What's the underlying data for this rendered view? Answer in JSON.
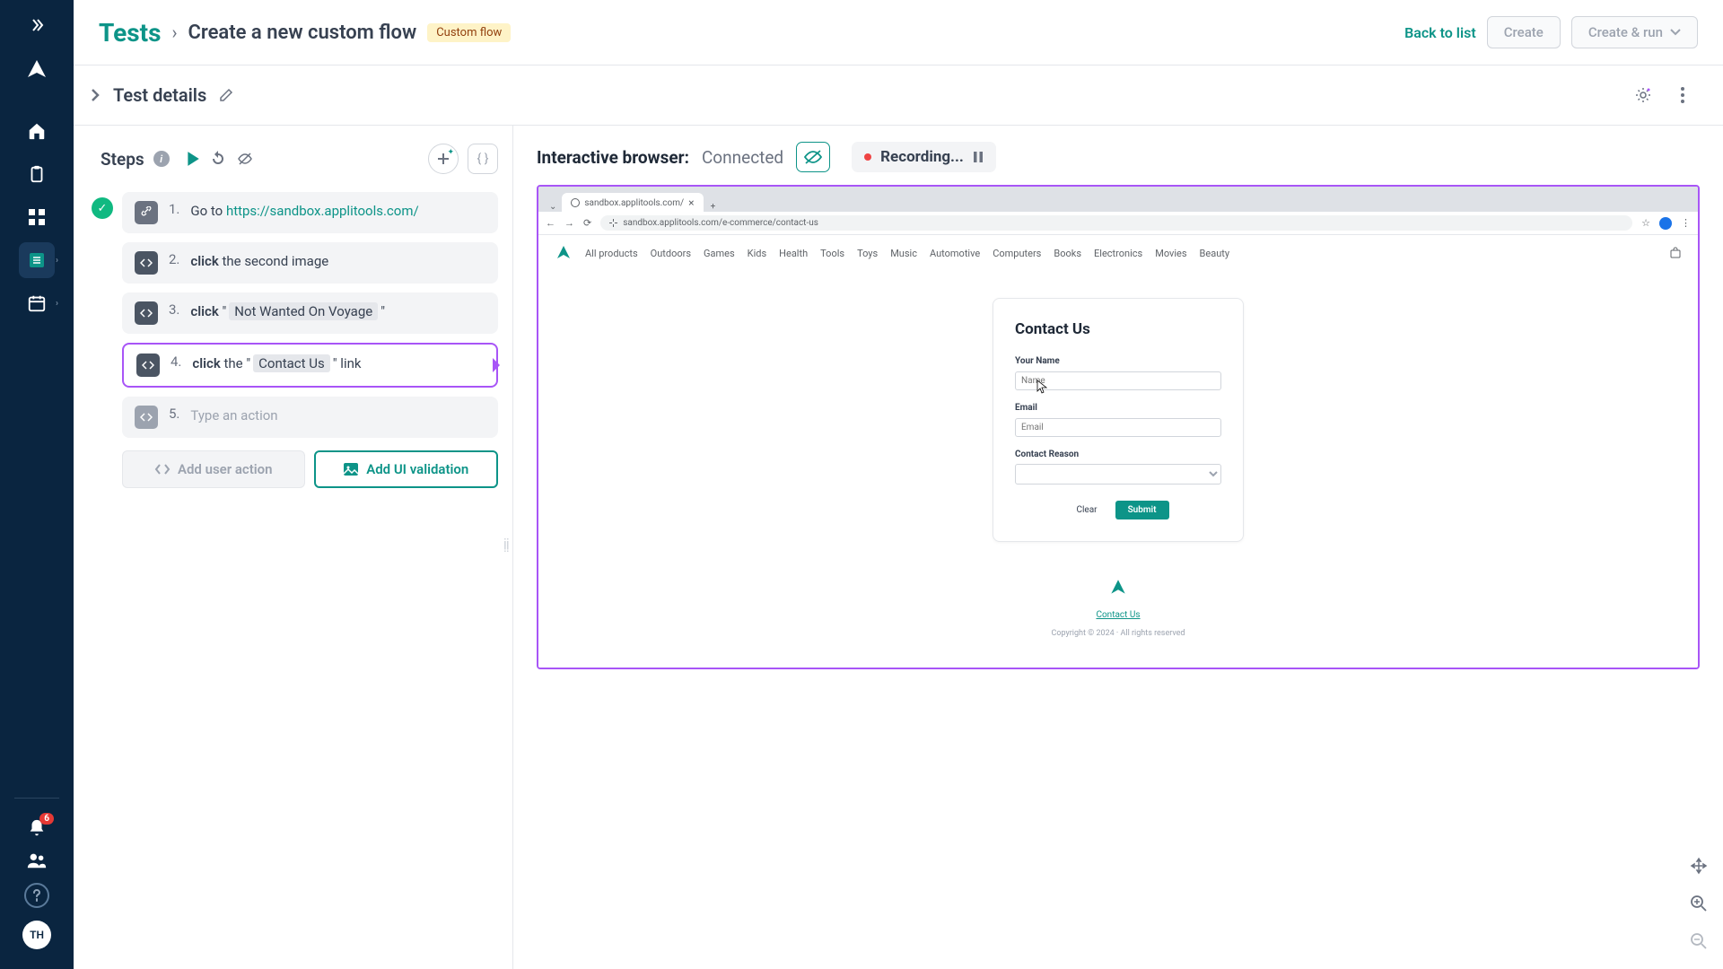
{
  "header": {
    "root": "Tests",
    "current": "Create a new custom flow",
    "badge": "Custom flow",
    "back": "Back to list",
    "create": "Create",
    "create_run": "Create & run"
  },
  "subheader": {
    "title": "Test details"
  },
  "steps": {
    "label": "Steps",
    "add_user": "Add user action",
    "add_ui": "Add UI validation",
    "items": [
      {
        "num": "1.",
        "prefix": "Go to",
        "url": "https://sandbox.applitools.com/"
      },
      {
        "num": "2.",
        "kw": "click",
        "rest": " the second image"
      },
      {
        "num": "3.",
        "kw": "click",
        "quote": "Not Wanted On Voyage"
      },
      {
        "num": "4.",
        "kw": "click",
        "mid": " the ",
        "quote": "Contact Us",
        "suffix": " link"
      },
      {
        "num": "5.",
        "placeholder": "Type an action"
      }
    ]
  },
  "browser": {
    "label": "Interactive browser:",
    "status": "Connected",
    "recording": "Recording...",
    "tab_title": "sandbox.applitools.com/",
    "url": "sandbox.applitools.com/e-commerce/contact-us"
  },
  "page": {
    "nav": [
      "All products",
      "Outdoors",
      "Games",
      "Kids",
      "Health",
      "Tools",
      "Toys",
      "Music",
      "Automotive",
      "Computers",
      "Books",
      "Electronics",
      "Movies",
      "Beauty"
    ],
    "contact_title": "Contact Us",
    "name_label": "Your Name",
    "name_ph": "Name",
    "email_label": "Email",
    "email_ph": "Email",
    "reason_label": "Contact Reason",
    "clear": "Clear",
    "submit": "Submit",
    "footer_link": "Contact Us",
    "copyright": "Copyright © 2024 · All rights reserved"
  },
  "notif_count": "6",
  "avatar": "TH"
}
